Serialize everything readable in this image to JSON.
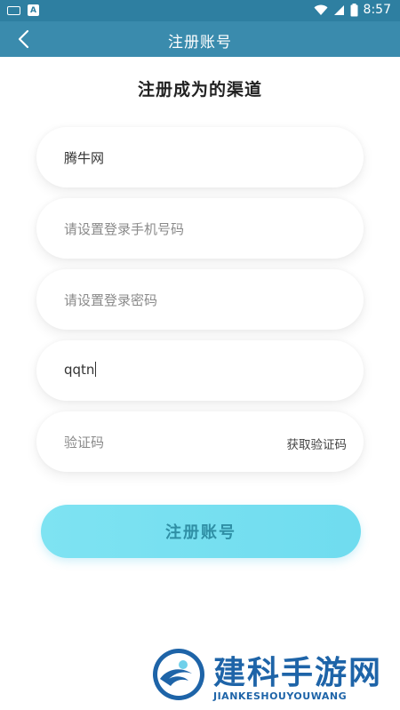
{
  "status_bar": {
    "time": "8:57",
    "icons": [
      "keyboard-icon",
      "a-badge-icon",
      "wifi-icon",
      "signal-icon",
      "battery-icon"
    ]
  },
  "title_bar": {
    "title": "注册账号",
    "background": "#3a8bad"
  },
  "heading": "注册成为的渠道",
  "form": {
    "channel_value": "腾牛网",
    "phone_placeholder": "请设置登录手机号码",
    "password_placeholder": "请设置登录密码",
    "invite_value": "qqtn",
    "code_placeholder": "验证码",
    "get_code_label": "获取验证码"
  },
  "submit": {
    "label": "注册账号",
    "color": "#7ee3f2"
  },
  "watermark": {
    "title": "建科手游网",
    "subtitle": "JIANKESHOUYOUWANG",
    "color": "#1e64a8"
  }
}
